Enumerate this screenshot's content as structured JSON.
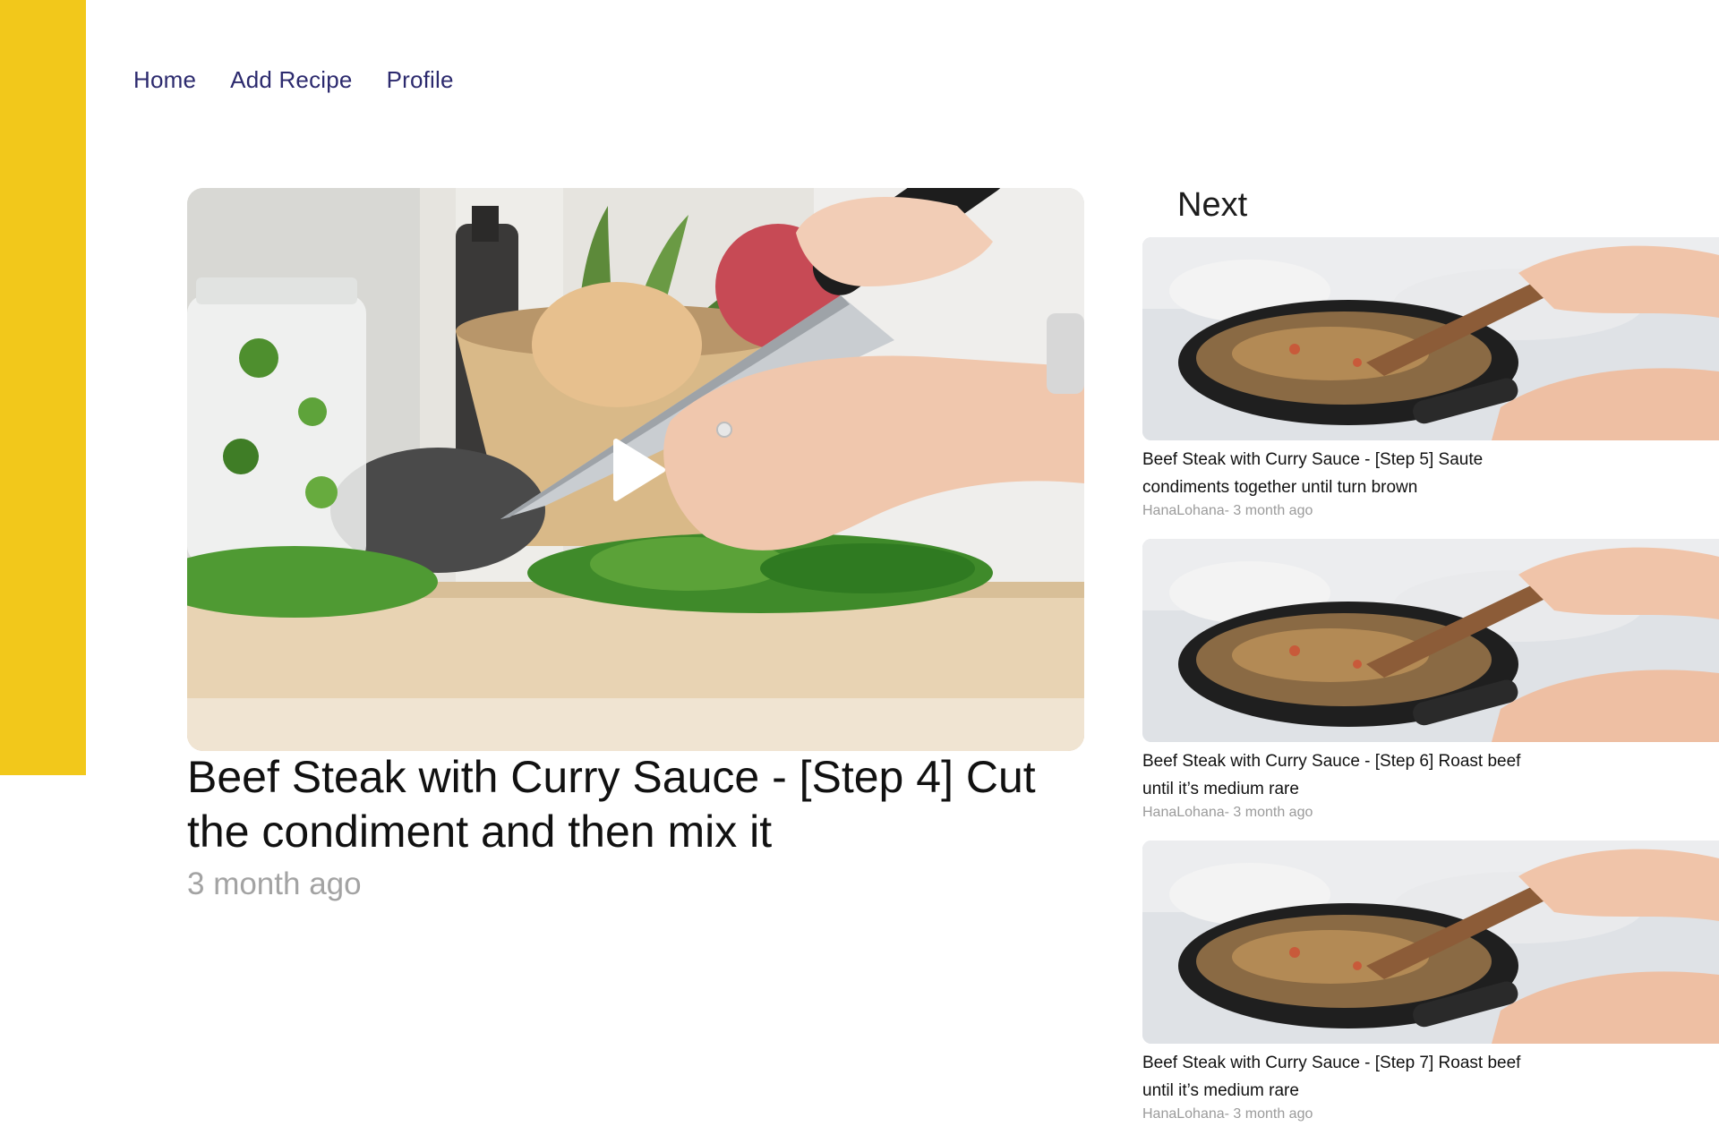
{
  "nav": {
    "items": [
      {
        "label": "Home"
      },
      {
        "label": "Add Recipe"
      },
      {
        "label": "Profile"
      }
    ]
  },
  "main": {
    "title": "Beef Steak with Curry Sauce - [Step 4] Cut the condiment and then mix it",
    "time": "3 month ago"
  },
  "next": {
    "heading": "Next",
    "items": [
      {
        "title": "Beef Steak with Curry Sauce - [Step 5] Saute condiments together until turn brown",
        "author": "HanaLohana",
        "separator": "- ",
        "time": "3 month ago"
      },
      {
        "title": "Beef Steak with Curry Sauce - [Step 6] Roast beef until it’s medium rare",
        "author": "HanaLohana",
        "separator": "- ",
        "time": "3 month ago"
      },
      {
        "title": "Beef Steak with Curry Sauce - [Step 7] Roast beef until it’s medium rare",
        "author": "HanaLohana",
        "separator": "- ",
        "time": "3 month ago"
      }
    ]
  },
  "colors": {
    "accent": "#f2c81b",
    "nav_text": "#2c2a6e",
    "muted": "#a3a3a3"
  },
  "icons": {
    "play": "play-icon"
  }
}
